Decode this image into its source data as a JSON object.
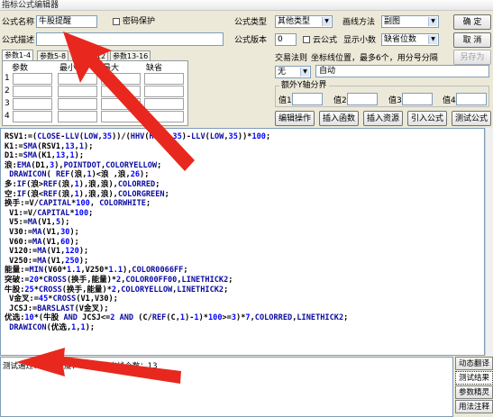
{
  "window": {
    "title": "指标公式编辑器"
  },
  "form": {
    "name_label": "公式名称",
    "name_value": "牛股提醒",
    "password_label": "密码保护",
    "desc_label": "公式描述",
    "desc_value": "",
    "type_label": "公式类型",
    "type_value": "其他类型",
    "draw_label": "画线方法",
    "draw_value": "副图",
    "version_label": "公式版本",
    "version_value": "0",
    "cloud_label": "云公式",
    "decimals_label": "显示小数",
    "decimals_value": "缺省位数",
    "trade_rule_label": "交易法则",
    "coord_label": "坐标线位置，最多6个，用分号分隔",
    "none_value": "无",
    "auto_value": "自动",
    "extra_axis_label": "额外Y轴分界",
    "value_labels": [
      "值1",
      "值2",
      "值3",
      "值4"
    ]
  },
  "buttons": {
    "ok": "确 定",
    "cancel": "取 消",
    "save_as": "另存为",
    "edit_op": "编辑操作",
    "insert_func": "插入函数",
    "insert_res": "插入资源",
    "import": "引入公式",
    "test": "测试公式"
  },
  "params": {
    "tabs": [
      "参数1-4",
      "参数5-8",
      "参数9-12",
      "参数13-16"
    ],
    "headers": [
      "参数",
      "最小",
      "最大",
      "缺省"
    ],
    "rows": [
      "1",
      "2",
      "3",
      "4"
    ]
  },
  "code_lines": [
    "RSV1:=(CLOSE-LLV(LOW,35))/(HHV(HIGH,35)-LLV(LOW,35))*100;",
    "K1:=SMA(RSV1,13,1);",
    "D1:=SMA(K1,13,1);",
    "浪:EMA(D1,3),POINTDOT,COLORYELLOW;",
    " DRAWICON( REF(浪,1)<浪 ,浪,26);",
    "多:IF(浪>REF(浪,1),浪,浪),COLORRED;",
    "空:IF(浪<REF(浪,1),浪,浪),COLORGREEN;",
    "换手:=V/CAPITAL*100, COLORWHITE;",
    " V1:=V/CAPITAL*100;",
    " V5:=MA(V1,5);",
    " V30:=MA(V1,30);",
    " V60:=MA(V1,60);",
    " V120:=MA(V1,120);",
    " V250:=MA(V1,250);",
    "能量:=MIN(V60*1.1,V250*1.1),COLOR0066FF;",
    "突破:=20*CROSS(换手,能量)*2,COLOR00FF00,LINETHICK2;",
    "牛股:25*CROSS(换手,能量)*2,COLORYELLOW,LINETHICK2;",
    " V金叉:=45*CROSS(V1,V30);",
    " JCSJ:=BARSLAST(V金叉);",
    "优选:10*(牛股 AND JCSJ<=2 AND (C/REF(C,1)-1)*100>=3)*7,COLORRED,LINETHICK2;",
    " DRAWICON(优选,1,1);"
  ],
  "status": {
    "text": "测试通过！代码长度：858，输出线个数：13"
  },
  "side_buttons": [
    "动态翻译",
    "测试结果",
    "参数精灵",
    "用法注释"
  ]
}
